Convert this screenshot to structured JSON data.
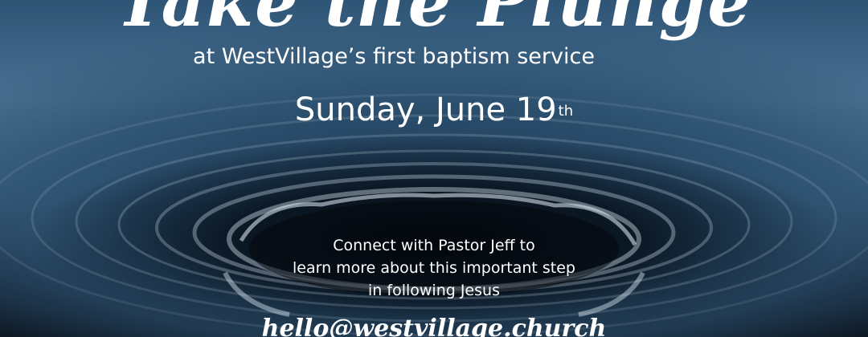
{
  "headline": "Take the Plunge",
  "subheadline": "at WestVillage’s first baptism service",
  "event_date": {
    "text": "Sunday, June 19",
    "ordinal_suffix": "th"
  },
  "info_lines": [
    "Connect with Pastor Jeff to",
    "learn more about this important step",
    "in following Jesus"
  ],
  "email": "hello@westvillage.church",
  "colors": {
    "text": "#ffffff",
    "water_light": "#4a7192",
    "water_dark": "#0b1825"
  }
}
